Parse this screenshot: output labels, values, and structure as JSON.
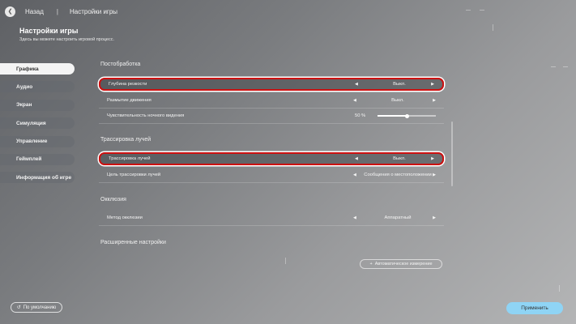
{
  "header": {
    "back_label": "Назад",
    "separator": "|",
    "breadcrumb": "Настройки игры"
  },
  "page": {
    "title": "Настройки игры",
    "subtitle": "Здесь вы можете настроить игровой процесс."
  },
  "sidebar": {
    "items": [
      {
        "label": "Графика",
        "active": true
      },
      {
        "label": "Аудио",
        "active": false
      },
      {
        "label": "Экран",
        "active": false
      },
      {
        "label": "Симуляция",
        "active": false
      },
      {
        "label": "Управление",
        "active": false
      },
      {
        "label": "Геймплей",
        "active": false
      },
      {
        "label": "Информация об игре",
        "active": false
      }
    ]
  },
  "sections": {
    "postprocessing": {
      "title": "Постобработка",
      "depth_of_field": {
        "label": "Глубина резкости",
        "value": "Выкл."
      },
      "motion_blur": {
        "label": "Размытие движения",
        "value": "Выкл."
      },
      "night_vision": {
        "label": "Чувствительность ночного видения",
        "value": "50 %",
        "level": 0.5
      }
    },
    "raytracing": {
      "title": "Трассировка лучей",
      "raytracing": {
        "label": "Трассировка лучей",
        "value": "Выкл."
      },
      "target": {
        "label": "Цель трассировки лучей",
        "value": "Сообщения о местоположении"
      }
    },
    "occlusion": {
      "title": "Окклюзия",
      "method": {
        "label": "Метод окклюзии",
        "value": "Аппаратный"
      }
    },
    "advanced": {
      "title": "Расширенные настройки",
      "auto_measure": "Автоматическое измерение"
    }
  },
  "glyphs": {
    "left": "◀",
    "right": "▶",
    "back": "❮",
    "plus": "+",
    "reset": "↺"
  },
  "footer": {
    "default_label": "По умолчанию",
    "apply_label": "Применить"
  },
  "colors": {
    "highlight_border": "#cc1111",
    "apply_button": "#8fd4f5",
    "active_tab": "#f4f4f4"
  }
}
